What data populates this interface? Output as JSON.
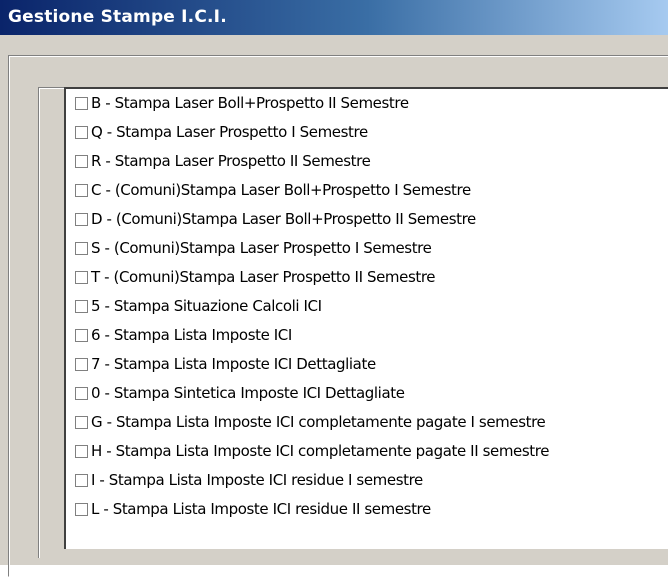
{
  "window": {
    "title": "Gestione Stampe I.C.I."
  },
  "print_options": [
    {
      "label": "B - Stampa Laser Boll+Prospetto II  Semestre",
      "checked": false
    },
    {
      "label": "Q - Stampa Laser Prospetto  I  Semestre",
      "checked": false
    },
    {
      "label": "R - Stampa Laser Prospetto II  Semestre",
      "checked": false
    },
    {
      "label": "C - (Comuni)Stampa Laser Boll+Prospetto  I  Semestre",
      "checked": false
    },
    {
      "label": "D - (Comuni)Stampa Laser Boll+Prospetto II  Semestre",
      "checked": false
    },
    {
      "label": "S - (Comuni)Stampa Laser Prospetto  I  Semestre",
      "checked": false
    },
    {
      "label": "T - (Comuni)Stampa Laser Prospetto II  Semestre",
      "checked": false
    },
    {
      "label": "5 - Stampa Situazione Calcoli ICI",
      "checked": false
    },
    {
      "label": "6 - Stampa Lista Imposte ICI",
      "checked": false
    },
    {
      "label": "7 - Stampa Lista Imposte ICI Dettagliate",
      "checked": false
    },
    {
      "label": "0 - Stampa Sintetica Imposte ICI Dettagliate",
      "checked": false
    },
    {
      "label": "G - Stampa Lista Imposte ICI completamente pagate I semestre",
      "checked": false
    },
    {
      "label": "H - Stampa Lista Imposte ICI completamente pagate II semestre",
      "checked": false
    },
    {
      "label": "I - Stampa Lista Imposte ICI residue I semestre",
      "checked": false
    },
    {
      "label": "L - Stampa Lista Imposte ICI residue II semestre",
      "checked": false
    }
  ]
}
